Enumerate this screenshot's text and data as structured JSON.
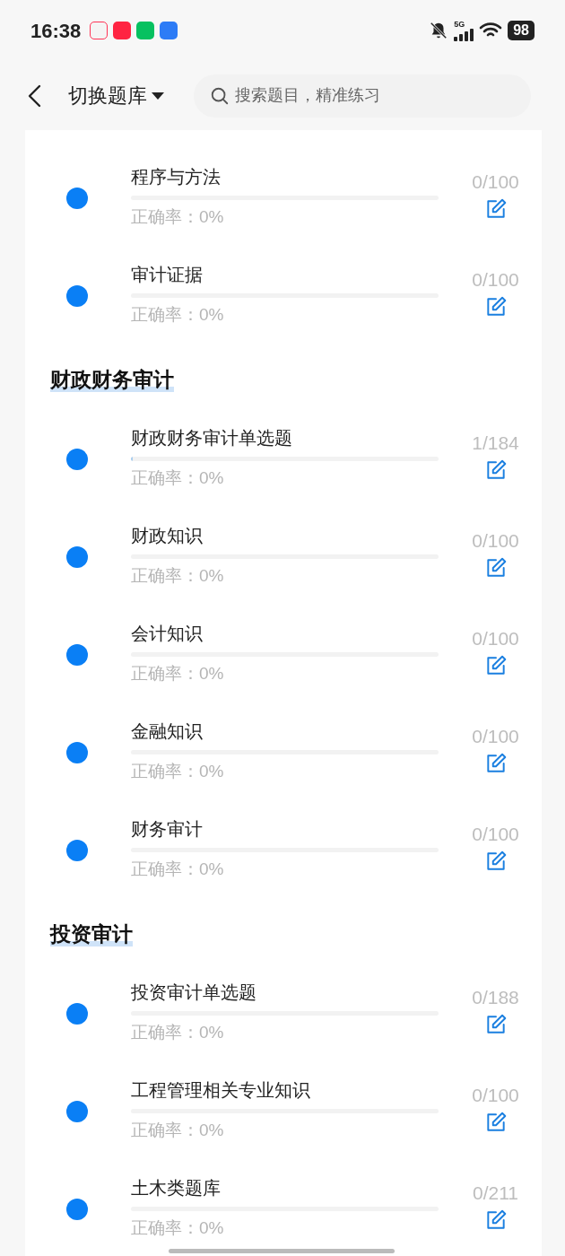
{
  "status_bar": {
    "time": "16:38",
    "network": "5G",
    "battery": "98"
  },
  "header": {
    "title": "切换题库",
    "search": {
      "placeholder": "搜索题目，精准练习"
    }
  },
  "groups": [
    {
      "items": [
        {
          "name": "程序与方法",
          "level": 0,
          "accuracy": "正确率：0%",
          "count": "0/100"
        },
        {
          "name": "审计证据",
          "level": 0,
          "accuracy": "正确率：0%",
          "count": "0/100"
        }
      ]
    },
    {
      "title": "财政财务审计",
      "items": [
        {
          "name": "财政财务审计单选题",
          "level": 0.0054,
          "accuracy": "正确率：0%",
          "count": "1/184"
        },
        {
          "name": "财政知识",
          "level": 0,
          "accuracy": "正确率：0%",
          "count": "0/100"
        },
        {
          "name": "会计知识",
          "level": 0,
          "accuracy": "正确率：0%",
          "count": "0/100"
        },
        {
          "name": "金融知识",
          "level": 0,
          "accuracy": "正确率：0%",
          "count": "0/100"
        },
        {
          "name": "财务审计",
          "level": 0,
          "accuracy": "正确率：0%",
          "count": "0/100"
        }
      ]
    },
    {
      "title": "投资审计",
      "items": [
        {
          "name": "投资审计单选题",
          "level": 0,
          "accuracy": "正确率：0%",
          "count": "0/188"
        },
        {
          "name": "工程管理相关专业知识",
          "level": 0,
          "accuracy": "正确率：0%",
          "count": "0/100"
        },
        {
          "name": "土木类题库",
          "level": 0,
          "accuracy": "正确率：0%",
          "count": "0/211"
        }
      ]
    }
  ]
}
